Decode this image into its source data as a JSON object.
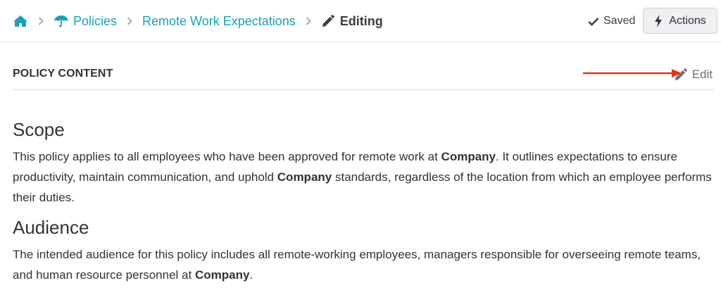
{
  "breadcrumb": {
    "home_icon": "home-icon",
    "policies_label": "Policies",
    "policy_label": "Remote Work Expectations",
    "current_label": "Editing"
  },
  "header": {
    "saved_label": "Saved",
    "actions_label": "Actions"
  },
  "section": {
    "title": "POLICY CONTENT",
    "edit_label": "Edit"
  },
  "document": {
    "scope_heading": "Scope",
    "scope_text": {
      "p1": "This policy applies to all employees who have been approved for remote work at ",
      "company1": "Company",
      "p2": ". It outlines expectations to ensure productivity, maintain communication, and uphold ",
      "company2": "Company",
      "p3": " standards, regardless of the location from which an employee performs their duties."
    },
    "audience_heading": "Audience",
    "audience_text": {
      "p1": "The intended audience for this policy includes all remote-working employees, managers responsible for overseeing remote teams, and human resource personnel at ",
      "company": "Company",
      "p2": "."
    }
  },
  "colors": {
    "link": "#17a2b8",
    "arrow": "#e8321c"
  }
}
